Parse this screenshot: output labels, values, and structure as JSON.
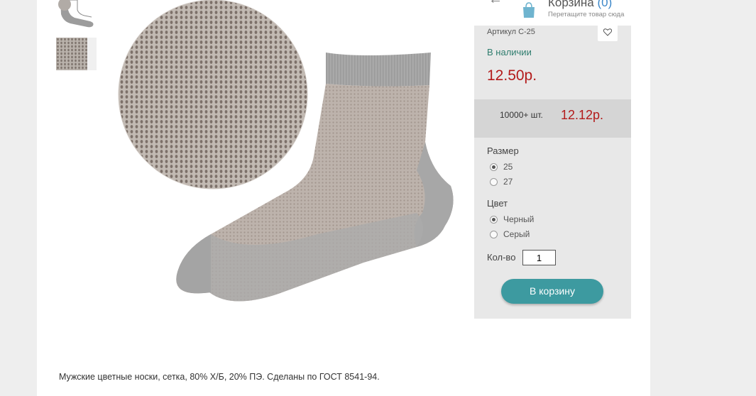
{
  "cart": {
    "title": "Корзина",
    "count": "(0)",
    "hint": "Перетащите товар сюда",
    "icons": {
      "back": "arrow-left-icon",
      "bag": "shopping-bag-icon"
    }
  },
  "product": {
    "sku": "Артикул С-25",
    "availability": "В наличии",
    "price": "12.50р.",
    "wholesale": {
      "quantity": "10000+ шт.",
      "price": "12.12р."
    },
    "size": {
      "label": "Размер",
      "options": [
        {
          "label": "25",
          "selected": true
        },
        {
          "label": "27",
          "selected": false
        }
      ]
    },
    "color": {
      "label": "Цвет",
      "options": [
        {
          "label": "Черный",
          "selected": true
        },
        {
          "label": "Серый",
          "selected": false
        }
      ]
    },
    "quantity": {
      "label": "Кол-во",
      "value": "1"
    },
    "buy_button": "В корзину",
    "description": "Мужские цветные носки, сетка, 80% Х/Б, 20% ПЭ. Сделаны по ГОСТ 8541-94."
  },
  "colors": {
    "price": "#b31a1a",
    "availability": "#2f7d6e",
    "button": "#3d9aa0",
    "cart_count": "#3a86c8"
  }
}
